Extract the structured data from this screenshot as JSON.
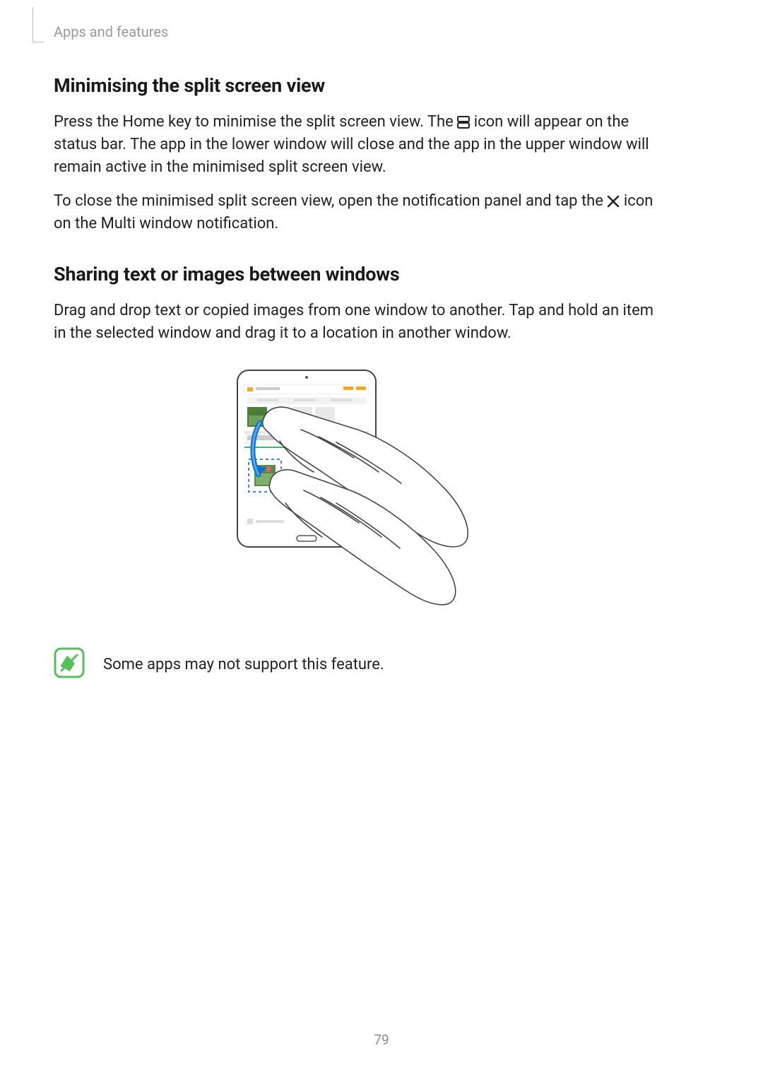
{
  "header": {
    "breadcrumb": "Apps and features"
  },
  "section1": {
    "title": "Minimising the split screen view",
    "p1_a": "Press the Home key to minimise the split screen view. The ",
    "p1_b": " icon will appear on the status bar. The app in the lower window will close and the app in the upper window will remain active in the minimised split screen view.",
    "p2_a": "To close the minimised split screen view, open the notification panel and tap the ",
    "p2_b": " icon on the Multi window notification."
  },
  "section2": {
    "title": "Sharing text or images between windows",
    "p1": "Drag and drop text or copied images from one window to another. Tap and hold an item in the selected window and drag it to a location in another window."
  },
  "note": {
    "text": "Some apps may not support this feature."
  },
  "page_number": "79"
}
